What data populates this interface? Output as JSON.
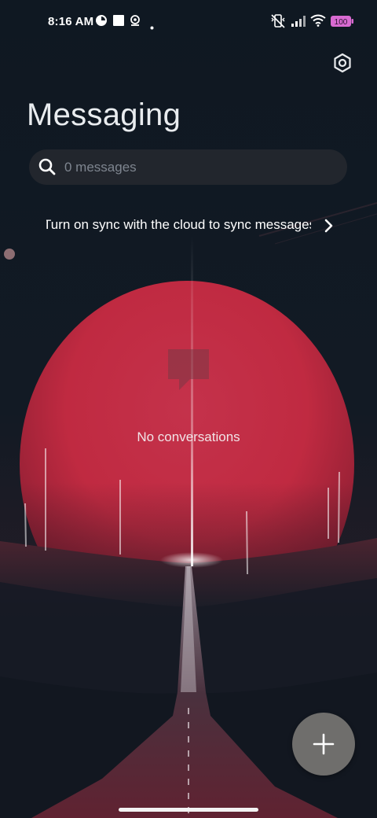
{
  "status_bar": {
    "time": "8:16 AM",
    "battery": "100",
    "icons": [
      "notification-dot-icon",
      "square-notification-icon",
      "location-pin-icon",
      "dot-icon",
      "vibrate-off-icon",
      "signal-icon",
      "wifi-icon",
      "battery-icon"
    ]
  },
  "header": {
    "title": "Messaging",
    "settings_icon": "gear-icon"
  },
  "search": {
    "placeholder": "0 messages",
    "value": ""
  },
  "sync_banner": {
    "text": "Turn on sync with the cloud to sync messages"
  },
  "empty_state": {
    "icon": "chat-bubble-icon",
    "text": "No conversations"
  },
  "fab": {
    "icon": "plus-icon"
  },
  "colors": {
    "background": "#0d1520",
    "moon": "#c83346",
    "search_bg": "#22262d",
    "fab_bg": "#6f6e6c",
    "battery": "#d86ad1"
  }
}
